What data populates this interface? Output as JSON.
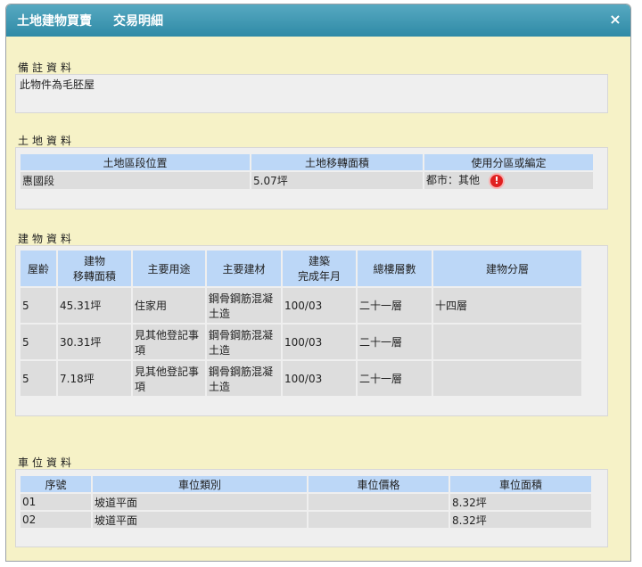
{
  "dialog": {
    "title_main": "土地建物買賣",
    "title_sub": "交易明細"
  },
  "notes": {
    "label": "備註資料",
    "text": "此物件為毛胚屋"
  },
  "land": {
    "label": "土地資料",
    "headers": [
      "土地區段位置",
      "土地移轉面積",
      "使用分區或編定"
    ],
    "rows": [
      {
        "location": "惠國段",
        "area": "5.07坪",
        "zoning": "都市：其他"
      }
    ]
  },
  "building": {
    "label": "建物資料",
    "headers": [
      "屋齡",
      "建物\n移轉面積",
      "主要用途",
      "主要建材",
      "建築\n完成年月",
      "總樓層數",
      "建物分層"
    ],
    "rows": [
      {
        "age": "5",
        "area": "45.31坪",
        "use": "住家用",
        "material": "鋼骨鋼筋混凝土造",
        "built": "100/03",
        "floors": "二十一層",
        "layer": "十四層"
      },
      {
        "age": "5",
        "area": "30.31坪",
        "use": "見其他登記事項",
        "material": "鋼骨鋼筋混凝土造",
        "built": "100/03",
        "floors": "二十一層",
        "layer": ""
      },
      {
        "age": "5",
        "area": "7.18坪",
        "use": "見其他登記事項",
        "material": "鋼骨鋼筋混凝土造",
        "built": "100/03",
        "floors": "二十一層",
        "layer": ""
      }
    ]
  },
  "parking": {
    "label": "車位資料",
    "headers": [
      "序號",
      "車位類別",
      "車位價格",
      "車位面積"
    ],
    "rows": [
      {
        "no": "01",
        "type": "坡道平面",
        "price": "",
        "area": "8.32坪"
      },
      {
        "no": "02",
        "type": "坡道平面",
        "price": "",
        "area": "8.32坪"
      }
    ]
  },
  "colors": {
    "title_bar": "#3b95b0",
    "body_bg": "#f6f2c7",
    "header_cell": "#bcd7f7",
    "data_cell": "#dddddd",
    "alert": "#e02020"
  }
}
